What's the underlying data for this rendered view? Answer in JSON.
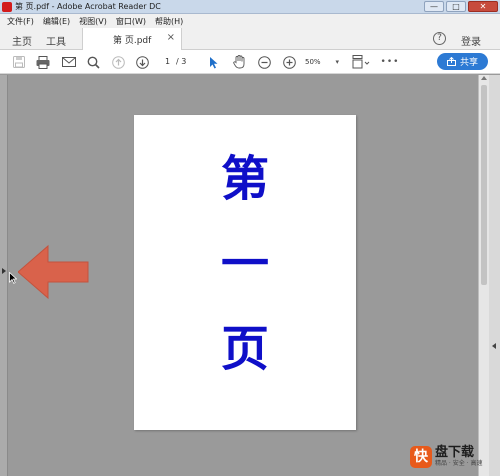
{
  "window": {
    "title": "第 页.pdf - Adobe Acrobat Reader DC",
    "controls": [
      "—",
      "□",
      "✕"
    ]
  },
  "menu": [
    "文件(F)",
    "编辑(E)",
    "视图(V)",
    "窗口(W)",
    "帮助(H)"
  ],
  "tabs": {
    "home": "主页",
    "tools": "工具",
    "document": "第 页.pdf",
    "close": "×",
    "help": "?",
    "signin": "登录"
  },
  "toolbar": {
    "icons": [
      "save-icon",
      "print-icon",
      "email-icon",
      "search-icon",
      "page-up-icon",
      "page-down-icon",
      "select-arrow-icon",
      "hand-tool-icon",
      "zoom-out-icon",
      "zoom-in-icon",
      "fit-page-icon",
      "more-icon"
    ],
    "page_current": "1",
    "page_total": "/ 3",
    "zoom": "50%",
    "zoom_caret": "▾",
    "more": "•••",
    "share": "共享",
    "share_color": "#2d7ad4"
  },
  "document_page": {
    "lines": [
      "第",
      "一",
      "页"
    ],
    "text_color": "#0f0fc8"
  },
  "annotation": {
    "arrow_color": "#d9624b"
  },
  "watermark": {
    "logo": "快",
    "name": "盘下载",
    "tagline": "精品 · 安全 · 高速"
  }
}
